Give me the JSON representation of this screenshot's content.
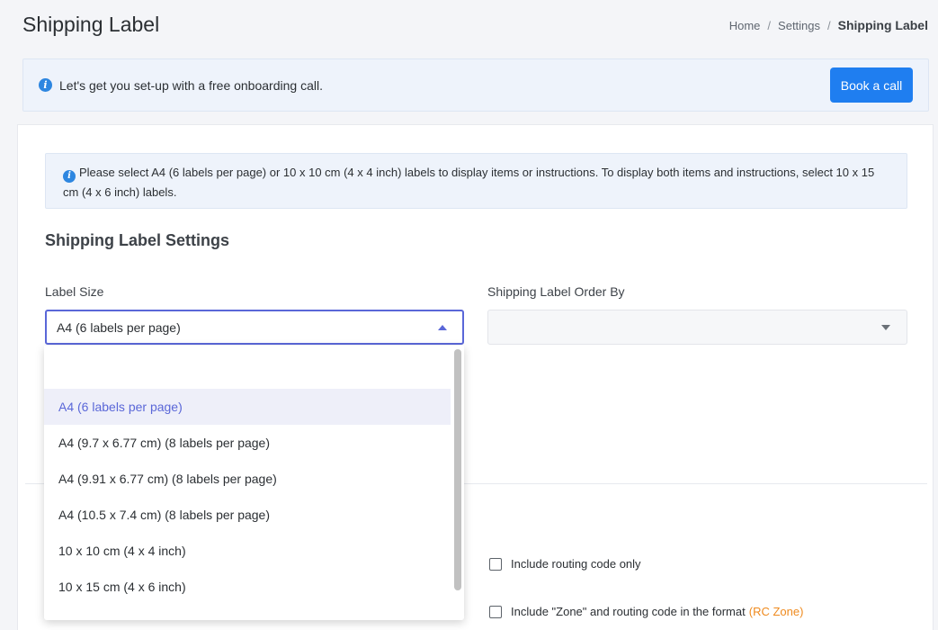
{
  "header": {
    "title": "Shipping Label",
    "breadcrumb": {
      "home": "Home",
      "settings": "Settings",
      "current": "Shipping Label",
      "separator": "/"
    }
  },
  "onboarding": {
    "text": "Let's get you set-up with a free onboarding call.",
    "button_label": "Book a call",
    "icon": "info-icon"
  },
  "notice": {
    "text": "Please select A4 (6 labels per page) or 10 x 10 cm (4 x 4 inch) labels to display items or instructions. To display both items and instructions, select 10 x 15 cm (4 x 6 inch) labels."
  },
  "settings": {
    "section_title": "Shipping Label Settings",
    "label_size": {
      "label": "Label Size",
      "value": "A4 (6 labels per page)",
      "options": [
        "A4 (6 labels per page)",
        "A4 (9.7 x 6.77 cm) (8 labels per page)",
        "A4 (9.91 x 6.77 cm) (8 labels per page)",
        "A4 (10.5 x 7.4 cm) (8 labels per page)",
        "10 x 10 cm (4 x 4 inch)",
        "10 x 15 cm (4 x 6 inch)"
      ]
    },
    "order_by": {
      "label": "Shipping Label Order By",
      "value": ""
    },
    "checkboxes": {
      "routing_only": "Include routing code only",
      "zone_routing": "Include \"Zone\" and routing code in the format",
      "rc_zone": "(RC Zone)"
    }
  },
  "colors": {
    "accent": "#5a67d8",
    "primary_button": "#1f7ef0",
    "info": "#2d86e0",
    "rc_zone": "#ef8a1e"
  }
}
